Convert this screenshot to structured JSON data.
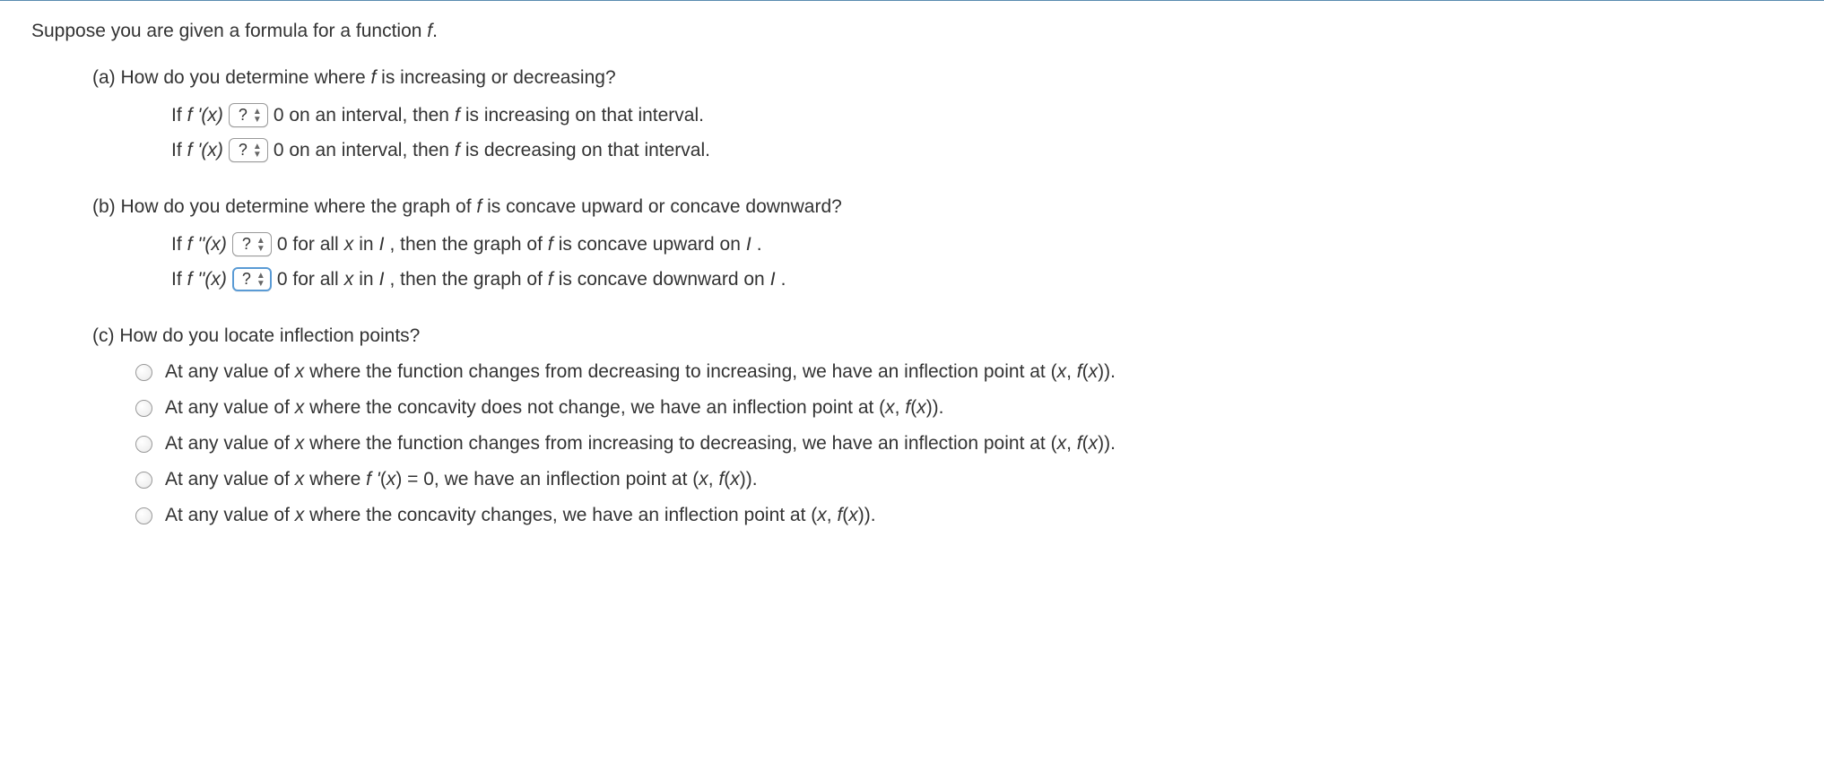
{
  "intro_pre": "Suppose you are given a formula for a function ",
  "intro_f": "f",
  "intro_post": ".",
  "partA": {
    "heading_pre": "(a) How do you determine where ",
    "heading_f": "f",
    "heading_post": " is increasing or decreasing?",
    "row1_pre": "If  ",
    "row1_fprime": "f '(x)",
    "dropdown": "?",
    "row1_mid": " 0  on an interval, then ",
    "row1_f": "f",
    "row1_post": " is increasing on that interval.",
    "row2_pre": "If  ",
    "row2_fprime": "f '(x)",
    "row2_mid": " 0  on an interval, then ",
    "row2_f": "f",
    "row2_post": " is decreasing on that interval."
  },
  "partB": {
    "heading_pre": "(b) How do you determine where the graph of ",
    "heading_f": "f",
    "heading_post": " is concave upward or concave downward?",
    "row1_pre": "If  ",
    "row1_fpp": "f ''(x)",
    "dropdown": "?",
    "row1_mid1": " 0 for all ",
    "row1_x": "x",
    "row1_mid2": " in ",
    "row1_I": "I",
    "row1_mid3": ", then the graph of ",
    "row1_f": "f",
    "row1_mid4": " is concave upward on ",
    "row1_I2": "I",
    "row1_post": ".",
    "row2_pre": "If  ",
    "row2_fpp": "f ''(x)",
    "row2_mid1": " 0 for all ",
    "row2_x": "x",
    "row2_mid2": " in ",
    "row2_I": "I",
    "row2_mid3": ", then the graph of ",
    "row2_f": "f",
    "row2_mid4": " is concave downward on ",
    "row2_I2": "I",
    "row2_post": "."
  },
  "partC": {
    "heading": "(c) How do you locate inflection points?",
    "options": {
      "o1": "At any value of x where the function changes from decreasing to increasing, we have an inflection point at (x, f(x)).",
      "o2": "At any value of x where the concavity does not change, we have an inflection point at (x, f(x)).",
      "o3": "At any value of x where the function changes from increasing to decreasing, we have an inflection point at (x, f(x)).",
      "o4": "At any value of x where f '(x) = 0, we have an inflection point at (x, f(x)).",
      "o5": "At any value of x where the concavity changes, we have an inflection point at (x, f(x))."
    }
  }
}
